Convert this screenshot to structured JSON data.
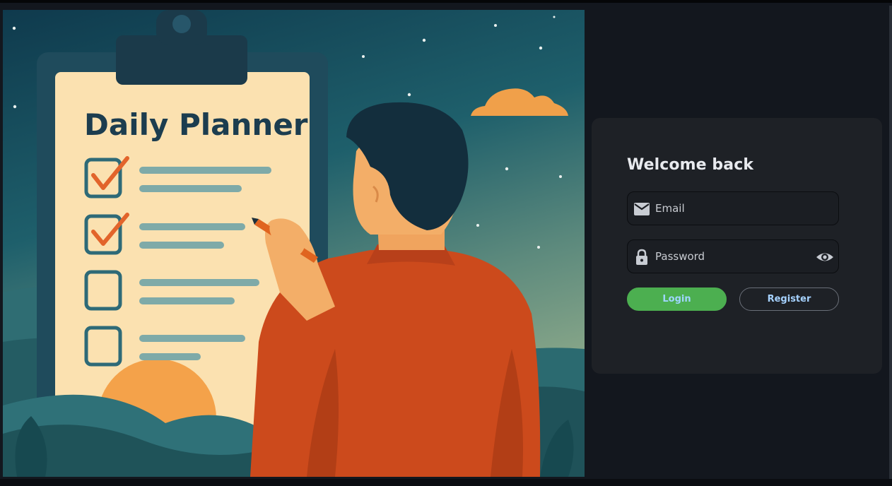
{
  "illustration": {
    "clipboard_title": "Daily Planner",
    "checklist": [
      {
        "checked": true
      },
      {
        "checked": true
      },
      {
        "checked": false
      },
      {
        "checked": false
      }
    ]
  },
  "login_card": {
    "heading": "Welcome back",
    "email": {
      "placeholder": "Email",
      "value": "",
      "icon": "envelope-icon"
    },
    "password": {
      "placeholder": "Password",
      "value": "",
      "icon": "lock-icon",
      "toggle_icon": "eye-icon"
    },
    "buttons": {
      "login_label": "Login",
      "register_label": "Register"
    }
  },
  "colors": {
    "page_background": "#13171e",
    "card_background": "#1e2126",
    "login_button": "#4caf50",
    "button_text": "#a6d2ff",
    "accent_orange": "#d4501e"
  }
}
